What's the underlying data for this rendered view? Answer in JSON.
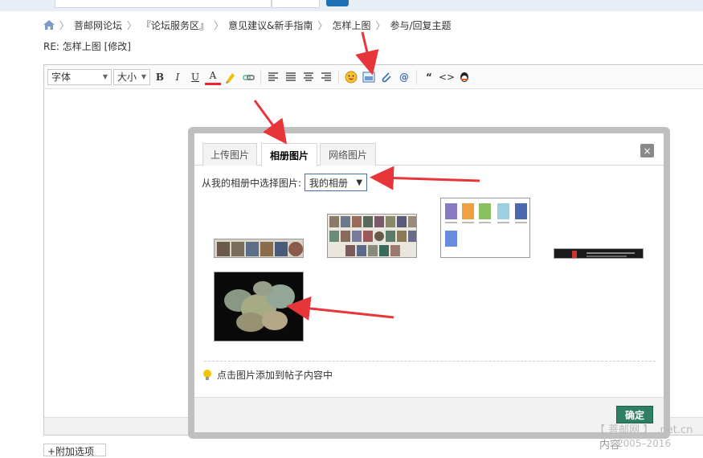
{
  "breadcrumb": {
    "items": [
      "菩邮网论坛",
      "『论坛服务区』",
      "意见建议&新手指南",
      "怎样上图",
      "参与/回复主题"
    ]
  },
  "post": {
    "title": "RE: 怎样上图 [修改]"
  },
  "toolbar": {
    "font_label": "字体",
    "size_label": "大小",
    "buttons": [
      "B",
      "I",
      "U",
      "A"
    ]
  },
  "dialog": {
    "tabs": [
      "上传图片",
      "相册图片",
      "网络图片"
    ],
    "active_tab": "相册图片",
    "close_label": "×",
    "album_prompt": "从我的相册中选择图片:",
    "album_select_value": "我的相册",
    "hint": "点击图片添加到帖子内容中",
    "confirm_label": "确定"
  },
  "attach": {
    "label": "+附加选项"
  },
  "watermark": {
    "line1": "【 菩邮网 】 .net.cn",
    "line1_extra": "内容",
    "line2": "2005–2016"
  },
  "colors": {
    "accent": "#1f6fb5",
    "confirm": "#2f7f66",
    "arrow": "#e8353a"
  }
}
